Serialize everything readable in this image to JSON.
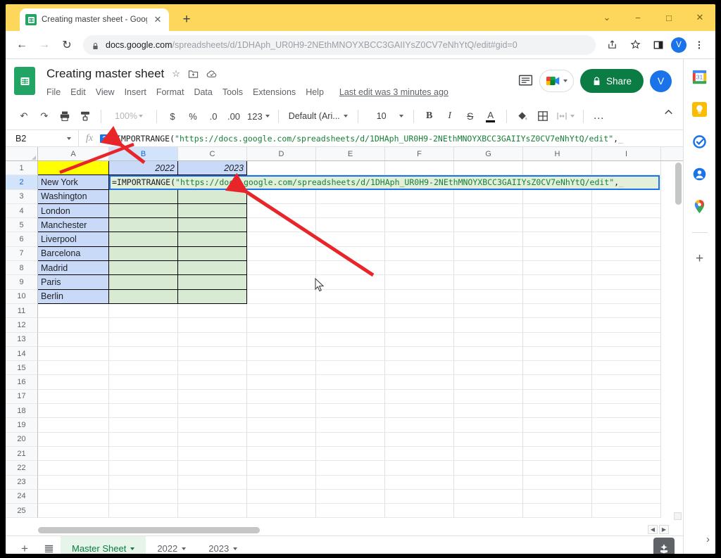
{
  "browser": {
    "tab": {
      "title": "Creating master sheet - Google S",
      "close_label": "✕",
      "favicon": "sheets-icon"
    },
    "new_tab_label": "+",
    "window_controls": {
      "minimize": "−",
      "maximize": "□",
      "close": "✕",
      "more": "⌄"
    },
    "nav": {
      "back": "←",
      "forward": "→",
      "reload": "↻"
    },
    "url_domain": "docs.google.com",
    "url_path": "/spreadsheets/d/1DHAph_UR0H9-2NEthMNOYXBCC3GAIIYsZ0CV7eNhYtQ/edit#gid=0",
    "profile_initial": "V"
  },
  "doc": {
    "title": "Creating master sheet",
    "star_icon": "☆",
    "move_icon": "move-to-folder-icon",
    "cloud_icon": "cloud-saved-icon",
    "menu": [
      "File",
      "Edit",
      "View",
      "Insert",
      "Format",
      "Data",
      "Tools",
      "Extensions",
      "Help"
    ],
    "last_edit": "Last edit was 3 minutes ago",
    "share_label": "Share",
    "profile_initial": "V"
  },
  "toolbar": {
    "undo": "↶",
    "redo": "↷",
    "print": "print-icon",
    "paint": "paint-format-icon",
    "zoom": "100%",
    "currency": "$",
    "percent": "%",
    "decrease_decimal": ".0",
    "increase_decimal": ".00",
    "more_formats": "123",
    "font": "Default (Ari...",
    "font_size": "10",
    "bold": "B",
    "italic": "I",
    "strikethrough": "S",
    "text_color": "A",
    "fill_color": "fill-color-icon",
    "borders": "borders-icon",
    "merge": "merge-cells-icon",
    "more": "…",
    "collapse": "⌃"
  },
  "formula_bar": {
    "name_box": "B2",
    "fx_symbol": "fx",
    "help_badge": "?",
    "formula_prefix": "=IMPORTRANGE(",
    "formula_url": "\"https://docs.google.com/spreadsheets/d/1DHAph_UR0H9-2NEthMNOYXBCC3GAIIYsZ0CV7eNhYtQ/edit\"",
    "formula_suffix": ","
  },
  "grid": {
    "columns": [
      "A",
      "B",
      "C",
      "D",
      "E",
      "F",
      "G",
      "H",
      "I"
    ],
    "selected_column": "B",
    "rows": [
      "1",
      "2",
      "3",
      "4",
      "5",
      "6",
      "7",
      "8",
      "9",
      "10",
      "11",
      "12",
      "13",
      "14",
      "15",
      "16",
      "17",
      "18",
      "19",
      "20",
      "21",
      "22",
      "23",
      "24",
      "25"
    ],
    "selected_row": "2",
    "header_years": [
      "2022",
      "2023"
    ],
    "cities": [
      "New York",
      "Washington",
      "London",
      "Manchester",
      "Liverpool",
      "Barcelona",
      "Madrid",
      "Paris",
      "Berlin"
    ],
    "editing_cell": "B2",
    "editing_text_prefix": "=IMPORTRANGE(",
    "editing_text_url": "\"https://docs.google.com/spreadsheets/d/1DHAph_UR0H9-2NEthMNOYXBCC3GAIIYsZ0CV7eNhYtQ/edit\"",
    "editing_text_suffix": ","
  },
  "sheet_tabs": {
    "add_label": "+",
    "all_sheets_label": "all-sheets-icon",
    "tabs": [
      {
        "label": "Master Sheet",
        "active": true
      },
      {
        "label": "2022",
        "active": false
      },
      {
        "label": "2023",
        "active": false
      }
    ],
    "explore_label": "explore-icon"
  },
  "rail": {
    "icons": [
      "calendar-icon",
      "keep-icon",
      "tasks-icon",
      "contacts-icon",
      "maps-icon"
    ],
    "add_label": "+",
    "expand_label": "›"
  },
  "colors": {
    "tabstrip": "#fcd75b",
    "sheets_green": "#0b7c43",
    "accent_blue": "#1a73e8",
    "cell_yellow": "#ffff00",
    "cell_blue": "#c9daf8",
    "cell_green": "#d9ead3",
    "formula_green": "#188038",
    "annotation_red": "#e8262a"
  }
}
